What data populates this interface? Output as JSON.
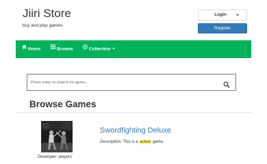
{
  "header": {
    "store_title": "Jiiri Store",
    "tagline": "buy and play games"
  },
  "auth": {
    "login_label": "Login",
    "register_label": "Register"
  },
  "nav": {
    "home_label": "Home",
    "browse_label": "Browse",
    "collection_label": "Collection"
  },
  "search": {
    "placeholder": "Press enter to search for game..."
  },
  "main": {
    "section_title": "Browse Games"
  },
  "games": [
    {
      "title": "Swordfighting Deluxe",
      "description_label": "Description:",
      "description_prefix": "This is a",
      "description_highlight": "action",
      "description_suffix": "game.",
      "developer_label": "Developer:",
      "developer_name": "player1"
    }
  ],
  "colors": {
    "nav_green": "#00b35a",
    "link_blue": "#337ab7",
    "register_blue": "#337ab7",
    "highlight_yellow": "#ffff66"
  },
  "icons": {
    "home": "home-icon",
    "browse": "list-icon",
    "collection": "circle-icon",
    "search": "search-icon",
    "login_caret": "chevron-down-icon"
  }
}
